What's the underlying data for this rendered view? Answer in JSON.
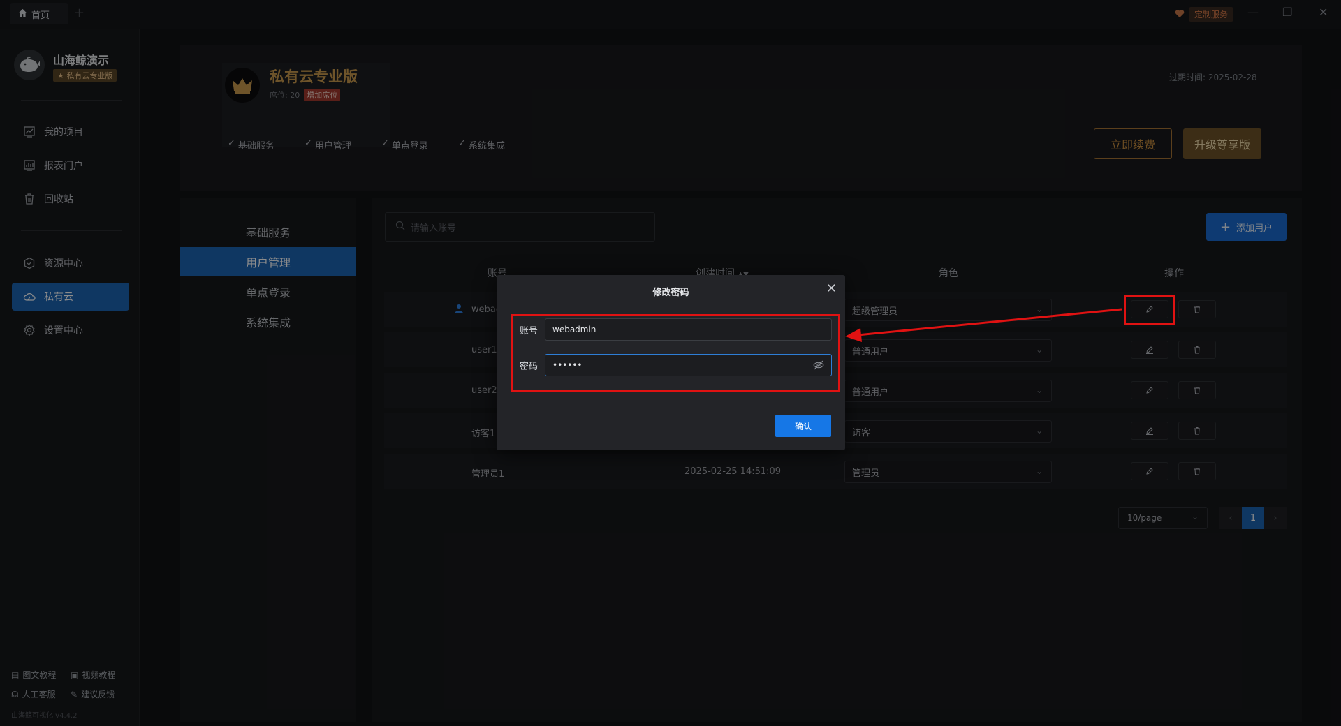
{
  "titlebar": {
    "tab_home": "首页",
    "custom_service": "定制服务"
  },
  "sidebar": {
    "org_name": "山海鲸演示",
    "org_badge": "★ 私有云专业版",
    "items": [
      {
        "label": "我的项目",
        "icon": "project-icon"
      },
      {
        "label": "报表门户",
        "icon": "report-icon"
      },
      {
        "label": "回收站",
        "icon": "trash-icon"
      },
      {
        "label": "资源中心",
        "icon": "resource-icon"
      },
      {
        "label": "私有云",
        "icon": "cloud-icon",
        "active": true
      },
      {
        "label": "设置中心",
        "icon": "gear-icon"
      }
    ],
    "footer": {
      "tutorial_text": "图文教程",
      "tutorial_video": "视频教程",
      "support": "人工客服",
      "feedback": "建议反馈",
      "version": "山海鲸可视化 v4.4.2"
    }
  },
  "banner": {
    "plan_title": "私有云专业版",
    "seats": "席位: 20",
    "add_seats": "增加席位",
    "expire": "过期时间:  2025-02-28",
    "features": [
      "基础服务",
      "用户管理",
      "单点登录",
      "系统集成"
    ],
    "renew": "立即续费",
    "upgrade": "升级尊享版"
  },
  "subnav": [
    "基础服务",
    "用户管理",
    "单点登录",
    "系统集成"
  ],
  "toolbar": {
    "search_placeholder": "请输入账号",
    "add_user": "添加用户"
  },
  "table": {
    "headers": [
      "账号",
      "创建时间",
      "角色",
      "操作"
    ],
    "rows": [
      {
        "account": "webadmin",
        "created": "",
        "role": "超级管理员"
      },
      {
        "account": "user1",
        "created": "",
        "role": "普通用户"
      },
      {
        "account": "user2",
        "created": "",
        "role": "普通用户"
      },
      {
        "account": "访客1",
        "created": "",
        "role": "访客"
      },
      {
        "account": "管理员1",
        "created": "2025-02-25 14:51:09",
        "role": "管理员"
      }
    ]
  },
  "pagination": {
    "page_size": "10/page",
    "current_page": "1"
  },
  "modal": {
    "title": "修改密码",
    "account_label": "账号",
    "account_value": "webadmin",
    "password_label": "密码",
    "password_value": "••••••",
    "confirm": "确认"
  },
  "colors": {
    "accent": "#1d64b3",
    "highlight": "#e01212",
    "gold": "#c99a4e"
  }
}
